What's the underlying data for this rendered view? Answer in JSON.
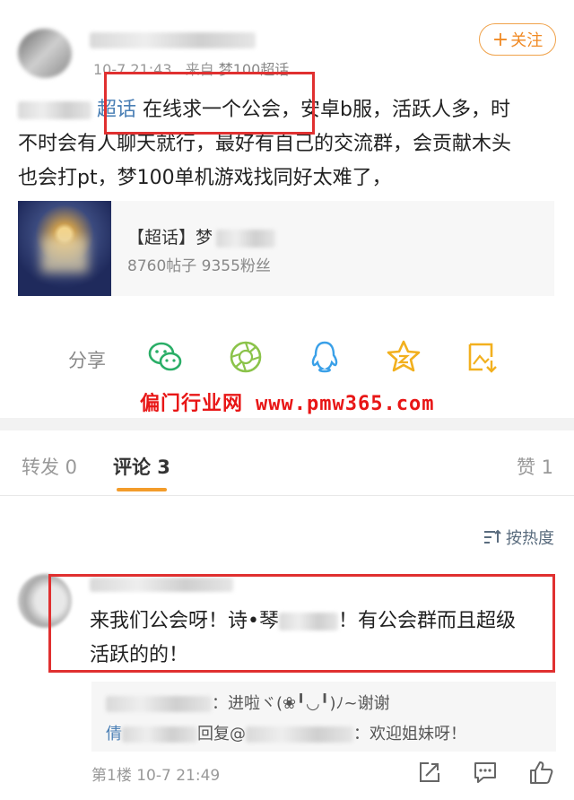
{
  "post": {
    "date": "10-7 21:43",
    "source_prefix": "来自",
    "source_name": "梦100超话",
    "follow_label": "关注",
    "follow_plus": "+",
    "tag_label": "超话",
    "text_line1": " 在线求一个公会，安卓b服，活跃人多，时",
    "text_line2": "不时会有人聊天就行，最好有自己的交流群，会贡献木头",
    "text_line3": "也会打pt，梦100单机游戏找同好太难了，"
  },
  "topic_card": {
    "title_prefix": "【超话】",
    "title_visible": "梦",
    "stats": "8760帖子 9355粉丝"
  },
  "share": {
    "label": "分享",
    "icons": [
      "wechat-icon",
      "moments-icon",
      "qq-icon",
      "qzone-icon",
      "save-image-icon"
    ]
  },
  "watermark": {
    "cn": "偏门行业网",
    "domain": "www.pmw365.com"
  },
  "tabs": {
    "repost": "转发 0",
    "comments": "评论 3",
    "likes": "赞 1"
  },
  "sort": {
    "label": "按热度"
  },
  "comment": {
    "text_part1": "来我们公会呀！诗•琴",
    "text_part2": "！有公会群而且超级",
    "text_line2": "活跃的的！",
    "reply1_suffix": "：进啦ヾ(❀╹◡╹)ﾉ~谢谢",
    "reply2_prefix": "倩",
    "reply2_mid": "回复@",
    "reply2_suffix": "：欢迎姐妹呀！",
    "floor_meta": "第1楼 10-7 21:49"
  },
  "colors": {
    "accent_orange": "#f08a24",
    "tag_blue": "#4a7fb5",
    "highlight_red": "#e03030",
    "watermark_red": "#e81616"
  }
}
